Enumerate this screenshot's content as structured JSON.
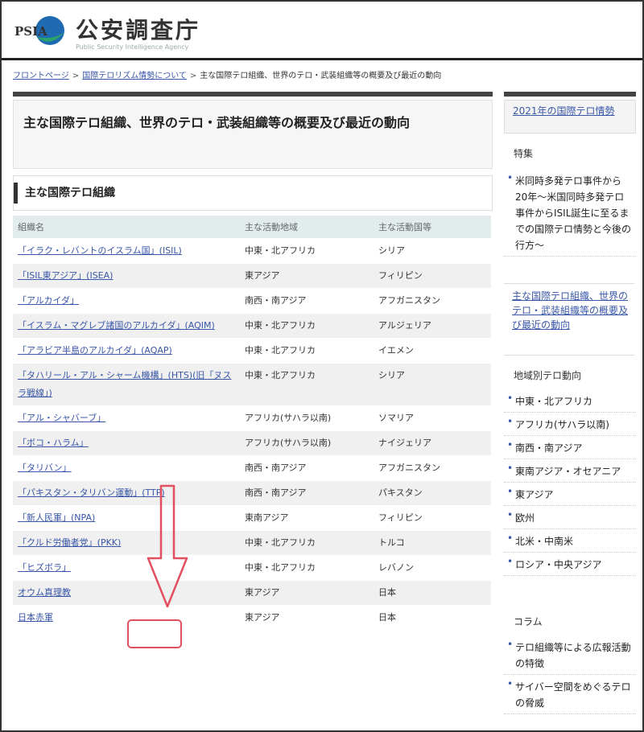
{
  "header": {
    "logo_abbr": "PSIA",
    "title": "公安調査庁",
    "subtitle": "Public Security Intelligence Agency"
  },
  "breadcrumb": [
    "フロントページ",
    "国際テロリズム情勢について",
    "主な国際テロ組織、世界のテロ・武装組織等の概要及び最近の動向"
  ],
  "main": {
    "page_title": "主な国際テロ組織、世界のテロ・武装組織等の概要及び最近の動向",
    "section_title": "主な国際テロ組織",
    "table": {
      "headers": [
        "組織名",
        "主な活動地域",
        "主な活動国等"
      ],
      "rows": [
        {
          "name": "「イラク・レバントのイスラム国」(ISIL)",
          "region": "中東・北アフリカ",
          "country": "シリア"
        },
        {
          "name": "「ISIL東アジア」(ISEA)",
          "region": "東アジア",
          "country": "フィリピン"
        },
        {
          "name": "「アルカイダ」",
          "region": "南西・南アジア",
          "country": "アフガニスタン"
        },
        {
          "name": "「イスラム・マグレブ諸国のアルカイダ」(AQIM)",
          "region": "中東・北アフリカ",
          "country": "アルジェリア"
        },
        {
          "name": "「アラビア半島のアルカイダ」(AQAP)",
          "region": "中東・北アフリカ",
          "country": "イエメン"
        },
        {
          "name": "「タハリール・アル・シャーム機構」(HTS)(旧「ヌスラ戦線」)",
          "region": "中東・北アフリカ",
          "country": "シリア"
        },
        {
          "name": "「アル・シャバーブ」",
          "region": "アフリカ(サハラ以南)",
          "country": "ソマリア"
        },
        {
          "name": "「ボコ・ハラム」",
          "region": "アフリカ(サハラ以南)",
          "country": "ナイジェリア"
        },
        {
          "name": "「タリバン」",
          "region": "南西・南アジア",
          "country": "アフガニスタン"
        },
        {
          "name": "「パキスタン・タリバン運動」(TTP)",
          "region": "南西・南アジア",
          "country": "パキスタン"
        },
        {
          "name": "「新人民軍」(NPA)",
          "region": "東南アジア",
          "country": "フィリピン"
        },
        {
          "name": "「クルド労働者党」(PKK)",
          "region": "中東・北アフリカ",
          "country": "トルコ"
        },
        {
          "name": "「ヒズボラ」",
          "region": "中東・北アフリカ",
          "country": "レバノン"
        },
        {
          "name": "オウム真理教",
          "region": "東アジア",
          "country": "日本"
        },
        {
          "name": "日本赤軍",
          "region": "東アジア",
          "country": "日本"
        }
      ]
    }
  },
  "sidebar": {
    "top_link": "2021年の国際テロ情勢",
    "special_head": "特集",
    "special_items": [
      "米同時多発テロ事件から20年〜米国同時多発テロ事件からISIL誕生に至るまでの国際テロ情勢と今後の行方〜"
    ],
    "feature_link": "主な国際テロ組織、世界のテロ・武装組織等の概要及び最近の動向",
    "region_head": "地域別テロ動向",
    "region_items": [
      "中東・北アフリカ",
      "アフリカ(サハラ以南)",
      "南西・南アジア",
      "東南アジア・オセアニア",
      "東アジア",
      "欧州",
      "北米・中南米",
      "ロシア・中央アジア"
    ],
    "column_head": "コラム",
    "column_items": [
      "テロ組織等による広報活動の特徴",
      "サイバー空間をめぐるテロの脅威"
    ]
  },
  "colors": {
    "link": "#3956a8",
    "table_header_bg": "#e3ecec",
    "annotation": "#e05060",
    "logo_blue": "#1f6ab0",
    "logo_green": "#2aa36b"
  }
}
